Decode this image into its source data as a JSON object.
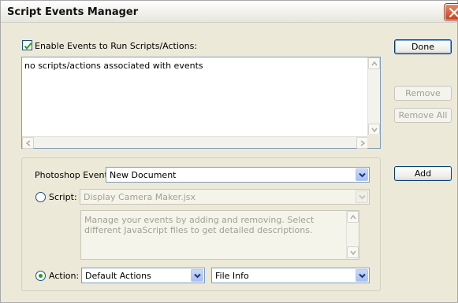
{
  "window": {
    "title": "Script Events Manager"
  },
  "enable": {
    "label": "Enable Events to Run Scripts/Actions:",
    "checked": true
  },
  "events_list": {
    "items": [
      "no scripts/actions associated with events"
    ]
  },
  "buttons": {
    "done": "Done",
    "remove": "Remove",
    "remove_all": "Remove All",
    "add": "Add"
  },
  "form": {
    "event_label": "Photoshop Event:",
    "event_value": "New Document",
    "script_label": "Script:",
    "script_value": "Display Camera Maker.jsx",
    "description": "Manage your events by adding and removing. Select different JavaScript files to get detailed descriptions.",
    "action_label": "Action:",
    "action_set": "Default Actions",
    "action_name": "File Info",
    "selected_mode": "action"
  },
  "colors": {
    "window_bg": "#ece9d8",
    "accent_green": "#21a121",
    "disabled_text": "#a1a192"
  }
}
